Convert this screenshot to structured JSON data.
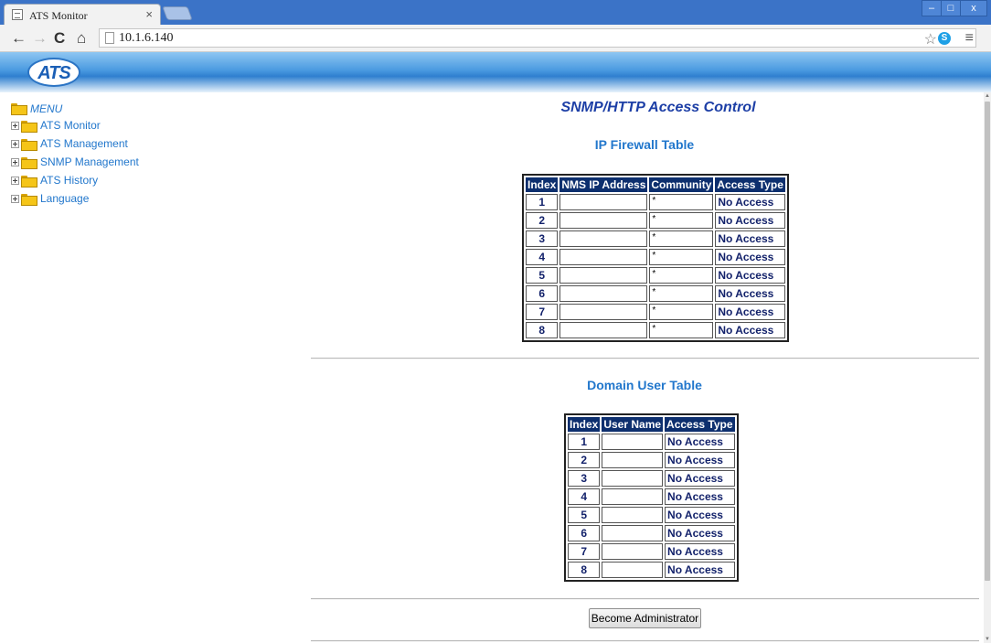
{
  "browser": {
    "tab_title": "ATS Monitor",
    "tab_close": "×",
    "url": "10.1.6.140",
    "window_buttons": {
      "minimize": "–",
      "maximize": "□",
      "close": "x"
    },
    "nav": {
      "back": "←",
      "forward": "→",
      "reload": "C",
      "home": "⌂"
    },
    "icons": {
      "star": "☆",
      "skype": "S",
      "menu": "≡"
    }
  },
  "header": {
    "logo_text": "ATS"
  },
  "sidebar": {
    "title": "MENU",
    "items": [
      {
        "label": "ATS Monitor"
      },
      {
        "label": "ATS Management"
      },
      {
        "label": "SNMP Management"
      },
      {
        "label": "ATS History"
      },
      {
        "label": "Language"
      }
    ]
  },
  "main": {
    "title": "SNMP/HTTP Access Control",
    "ip_firewall": {
      "title": "IP Firewall Table",
      "columns": [
        "Index",
        "NMS IP Address",
        "Community",
        "Access Type"
      ],
      "rows": [
        {
          "index": "1",
          "ip": "",
          "community": "*",
          "access": "No Access"
        },
        {
          "index": "2",
          "ip": "",
          "community": "*",
          "access": "No Access"
        },
        {
          "index": "3",
          "ip": "",
          "community": "*",
          "access": "No Access"
        },
        {
          "index": "4",
          "ip": "",
          "community": "*",
          "access": "No Access"
        },
        {
          "index": "5",
          "ip": "",
          "community": "*",
          "access": "No Access"
        },
        {
          "index": "6",
          "ip": "",
          "community": "*",
          "access": "No Access"
        },
        {
          "index": "7",
          "ip": "",
          "community": "*",
          "access": "No Access"
        },
        {
          "index": "8",
          "ip": "",
          "community": "*",
          "access": "No Access"
        }
      ]
    },
    "domain_user": {
      "title": "Domain User Table",
      "columns": [
        "Index",
        "User Name",
        "Access Type"
      ],
      "rows": [
        {
          "index": "1",
          "user": "",
          "access": "No Access"
        },
        {
          "index": "2",
          "user": "",
          "access": "No Access"
        },
        {
          "index": "3",
          "user": "",
          "access": "No Access"
        },
        {
          "index": "4",
          "user": "",
          "access": "No Access"
        },
        {
          "index": "5",
          "user": "",
          "access": "No Access"
        },
        {
          "index": "6",
          "user": "",
          "access": "No Access"
        },
        {
          "index": "7",
          "user": "",
          "access": "No Access"
        },
        {
          "index": "8",
          "user": "",
          "access": "No Access"
        }
      ]
    },
    "admin_button": "Become Administrator"
  },
  "colors": {
    "chrome_frame": "#3b73c7",
    "link_blue": "#2277cc",
    "title_blue": "#1d3fa6",
    "table_header": "#0d2f6e"
  }
}
